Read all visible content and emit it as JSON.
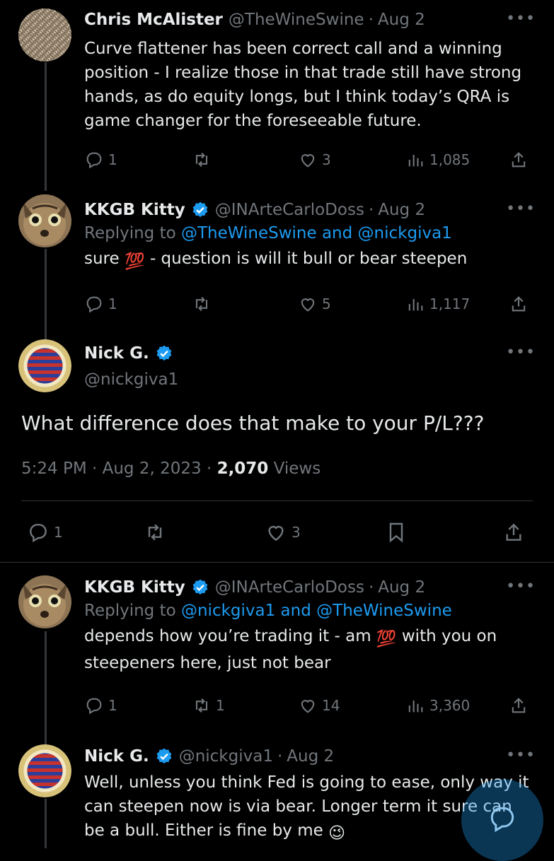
{
  "tweets": [
    {
      "name": "Chris McAlister",
      "handle": "@TheWineSwine",
      "date": "Aug 2",
      "text": "Curve flattener has been correct call and a winning position - I realize those in that trade still have strong hands, as do equity longs, but I think today’s QRA is game changer for the foreseeable future.",
      "replies": "1",
      "retweets": "",
      "likes": "3",
      "views": "1,085"
    },
    {
      "name": "KKGB Kitty",
      "handle": "@INArteCarloDoss",
      "date": "Aug 2",
      "replying_prefix": "Replying to",
      "replying_to": "@TheWineSwine and @nickgiva1",
      "text_before": "sure",
      "emoji": "💯",
      "text_after": "- question is will it bull or bear steepen",
      "replies": "1",
      "retweets": "",
      "likes": "5",
      "views": "1,117"
    },
    {
      "name": "KKGB Kitty",
      "handle": "@INArteCarloDoss",
      "date": "Aug 2",
      "replying_prefix": "Replying to",
      "replying_to": "@nickgiva1 and @TheWineSwine",
      "text_before": "depends how you’re trading it - am",
      "emoji": "💯",
      "text_after": "with you on steepeners here, just not bear",
      "replies": "1",
      "retweets": "1",
      "likes": "14",
      "views": "3,360"
    },
    {
      "name": "Nick G.",
      "handle": "@nickgiva1",
      "date": "Aug 2",
      "text": "Well, unless you think Fed is going to ease, only way it can steepen now is via bear. Longer term it sure can be a bull.  Either is fine by me",
      "emoji": "😉"
    }
  ],
  "main_tweet": {
    "name": "Nick G.",
    "handle": "@nickgiva1",
    "text": "What difference does that make to your P/L???",
    "timestamp": "5:24 PM · Aug 2, 2023 · ",
    "views_count": "2,070",
    "views_label": " Views",
    "replies": "1",
    "retweets": "",
    "likes": "3"
  },
  "separator": "·",
  "more_label": "•••"
}
